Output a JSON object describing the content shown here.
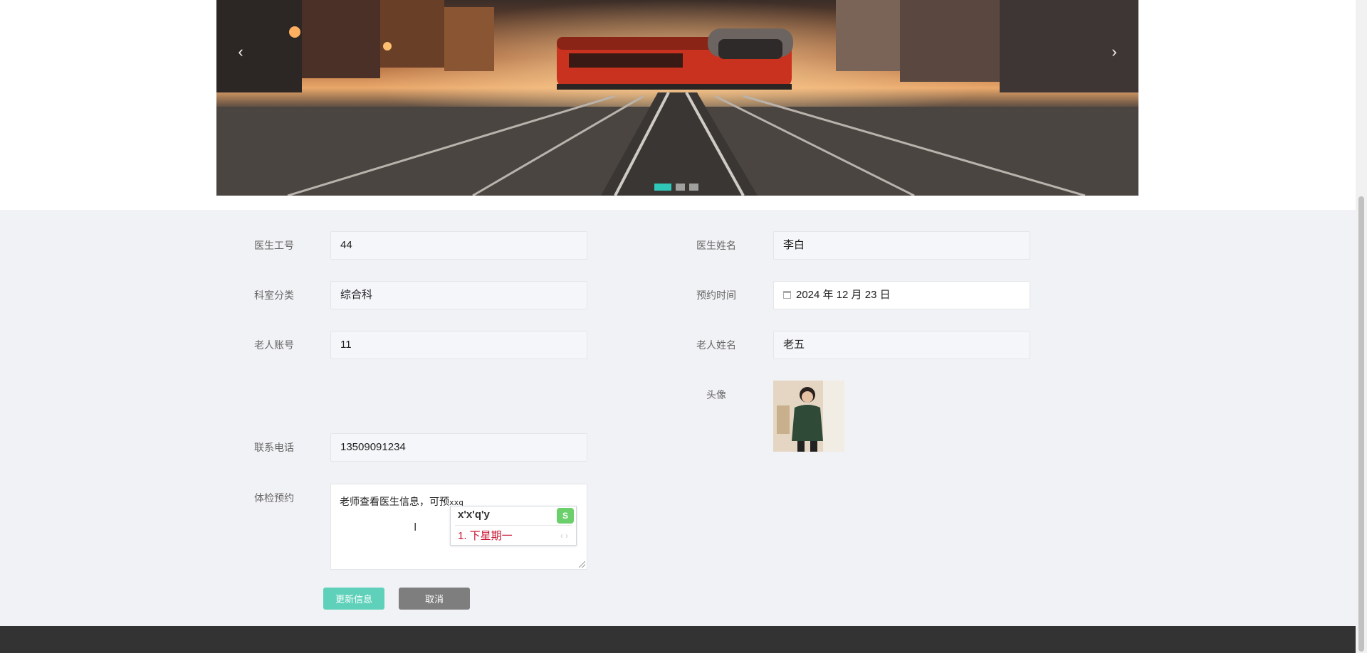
{
  "carousel": {
    "prev_label": "‹",
    "next_label": "›",
    "slide_count": 3,
    "active_slide": 1,
    "image": "red-train-on-railway-tracks-in-city"
  },
  "form": {
    "doctor_id": {
      "label": "医生工号",
      "value": "44"
    },
    "doctor_name": {
      "label": "医生姓名",
      "value": "李白"
    },
    "department": {
      "label": "科室分类",
      "value": "综合科"
    },
    "appointment_time": {
      "label": "预约时间",
      "value": "2024 年 12 月 23 日",
      "icon": "calendar-icon"
    },
    "elder_account": {
      "label": "老人账号",
      "value": "11"
    },
    "elder_name": {
      "label": "老人姓名",
      "value": "老五"
    },
    "avatar": {
      "label": "头像",
      "image": "woman-in-green-winter-coat"
    },
    "phone": {
      "label": "联系电话",
      "value": "13509091234"
    },
    "checkup": {
      "label": "体检预约",
      "value_text": "老师查看医生信息，可预",
      "value_typing": "xxq"
    },
    "ime": {
      "composition": "x'x'q'y",
      "candidate": "1. 下星期一",
      "logo": "S"
    }
  },
  "buttons": {
    "update": "更新信息",
    "cancel": "取消"
  },
  "colors": {
    "accent": "#5fd1ba",
    "carousel_active": "#2ec7b8",
    "cancel_button": "#7e7e7e",
    "form_background": "#f1f2f5",
    "footer": "#333333"
  }
}
